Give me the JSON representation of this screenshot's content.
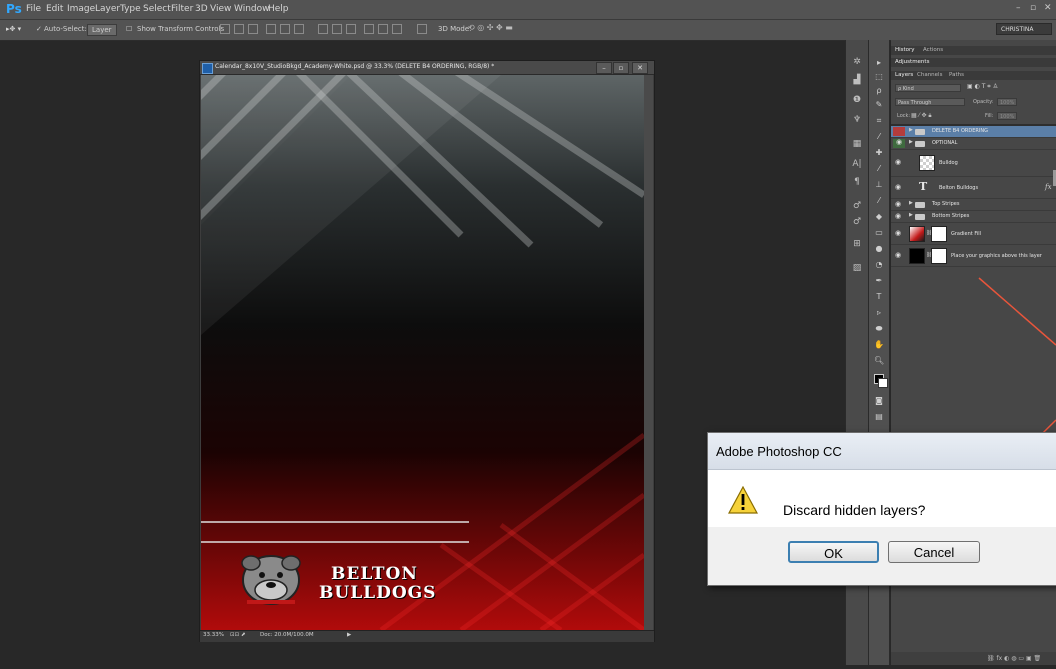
{
  "app": {
    "logo": "Ps",
    "menu": [
      "File",
      "Edit",
      "Image",
      "Layer",
      "Type",
      "Select",
      "Filter",
      "3D",
      "View",
      "Window",
      "Help"
    ],
    "window_controls": [
      "–",
      "▫",
      "✕"
    ]
  },
  "options_bar": {
    "auto_select_label": "Auto-Select:",
    "auto_select_value": "Layer",
    "show_transform_label": "Show Transform Controls",
    "mode_label": "3D Mode:",
    "workspace": "CHRISTINA"
  },
  "document": {
    "title": "Calendar_8x10V_StudioBkgd_Academy-White.psd @ 33.3% (DELETE B4 ORDERING, RGB/8) *",
    "brand_line1": "BELTON",
    "brand_line2": "BULLDOGS",
    "zoom": "33.33%",
    "doc_size": "Doc: 20.0M/100.0M"
  },
  "panels": {
    "top_tabs": [
      "History",
      "Actions"
    ],
    "adjustments_tab": "Adjustments",
    "layer_tabs": [
      "Layers",
      "Channels",
      "Paths"
    ],
    "kind_label": "ρ Kind",
    "blend_mode": "Pass Through",
    "opacity_label": "Opacity:",
    "opacity_value": "100%",
    "lock_label": "Lock:",
    "fill_label": "Fill:",
    "fill_value": "100%",
    "layers": [
      {
        "name": "DELETE B4 ORDERING",
        "kind": "group",
        "visible": false,
        "selected": true
      },
      {
        "name": "OPTIONAL",
        "kind": "group",
        "visible": true,
        "selected": false
      },
      {
        "name": "Bulldog",
        "kind": "smart",
        "visible": true,
        "selected": false
      },
      {
        "name": "Belton Bulldogs",
        "kind": "type",
        "visible": true,
        "selected": false
      },
      {
        "name": "Top Stripes",
        "kind": "group",
        "visible": true,
        "selected": false
      },
      {
        "name": "Bottom Stripes",
        "kind": "group",
        "visible": true,
        "selected": false
      },
      {
        "name": "Gradient Fill",
        "kind": "fill",
        "visible": true,
        "selected": false
      },
      {
        "name": "Place your graphics above this layer",
        "kind": "fill",
        "visible": true,
        "selected": false
      }
    ]
  },
  "dialog": {
    "title": "Adobe Photoshop CC",
    "message": "Discard hidden layers?",
    "ok_label": "OK",
    "cancel_label": "Cancel"
  },
  "colors": {
    "annotation_line": "#e8553b",
    "selected_layer": "#5b7fa8",
    "hidden_eye_box": "#b43c3c"
  }
}
